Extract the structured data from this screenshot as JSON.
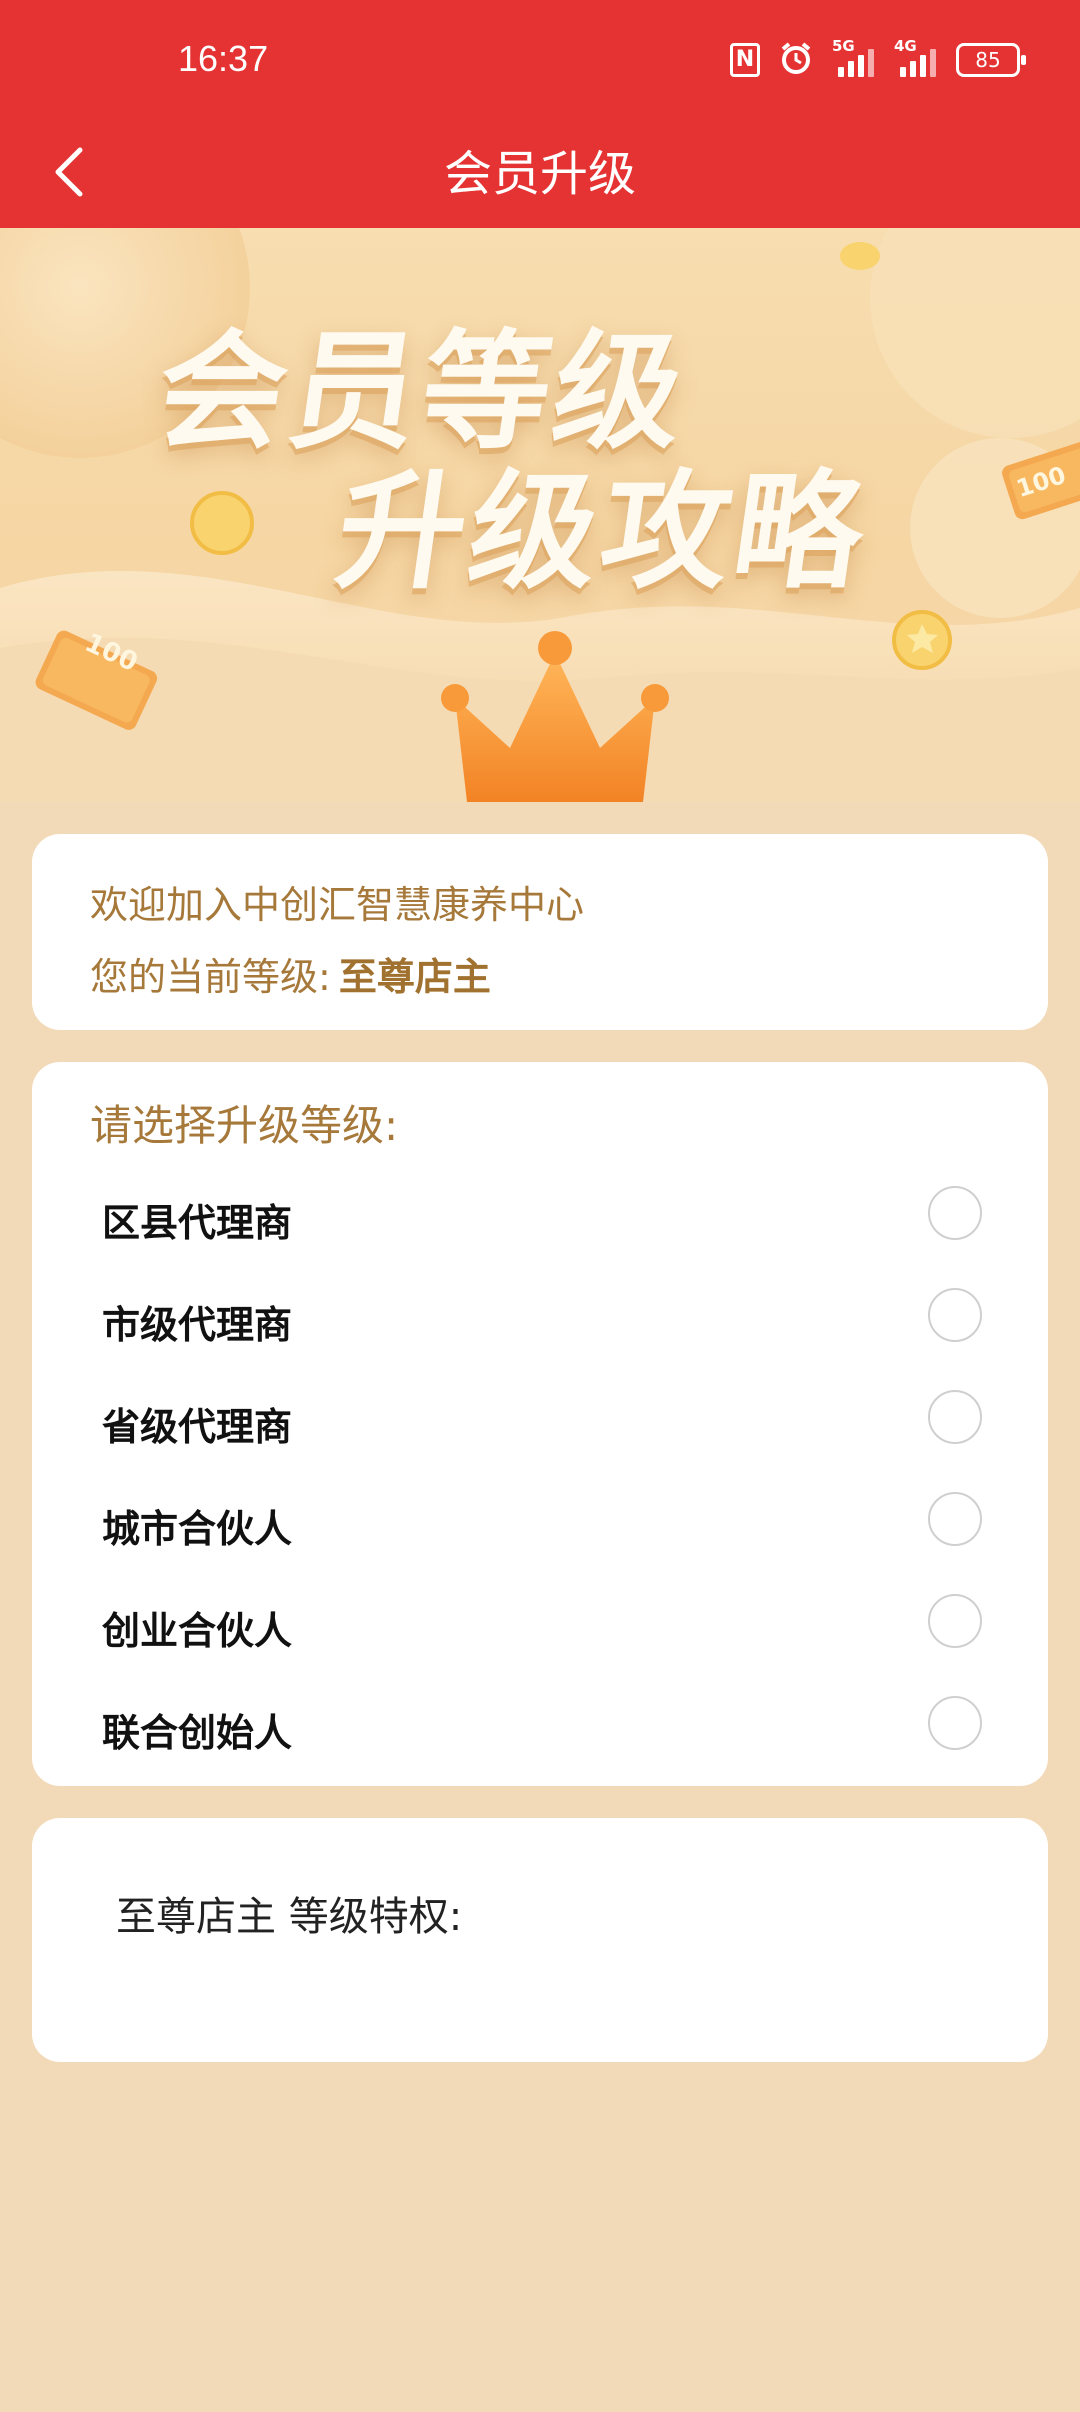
{
  "status_bar": {
    "time": "16:37",
    "nfc_icon": "N",
    "signal1_label": "5G",
    "signal2_label": "4G",
    "battery": "85"
  },
  "navbar": {
    "title": "会员升级",
    "back_icon": "chevron-left-icon"
  },
  "banner": {
    "line1": "会员等级",
    "line2": "升级攻略",
    "coin_left": "100",
    "coin_right": "100"
  },
  "info_card": {
    "welcome": "欢迎加入中创汇智慧康养中心",
    "current_label": "您的当前等级:",
    "current_level": "至尊店主"
  },
  "upgrade_card": {
    "title": "请选择升级等级:",
    "options": [
      {
        "label": "区县代理商",
        "selected": false
      },
      {
        "label": "市级代理商",
        "selected": false
      },
      {
        "label": "省级代理商",
        "selected": false
      },
      {
        "label": "城市合伙人",
        "selected": false
      },
      {
        "label": "创业合伙人",
        "selected": false
      },
      {
        "label": "联合创始人",
        "selected": false
      }
    ]
  },
  "privilege_card": {
    "text": "至尊店主 等级特权:"
  },
  "colors": {
    "header_red": "#e53333",
    "page_bg": "#f2d9b7",
    "gold_text": "#a6793b"
  }
}
